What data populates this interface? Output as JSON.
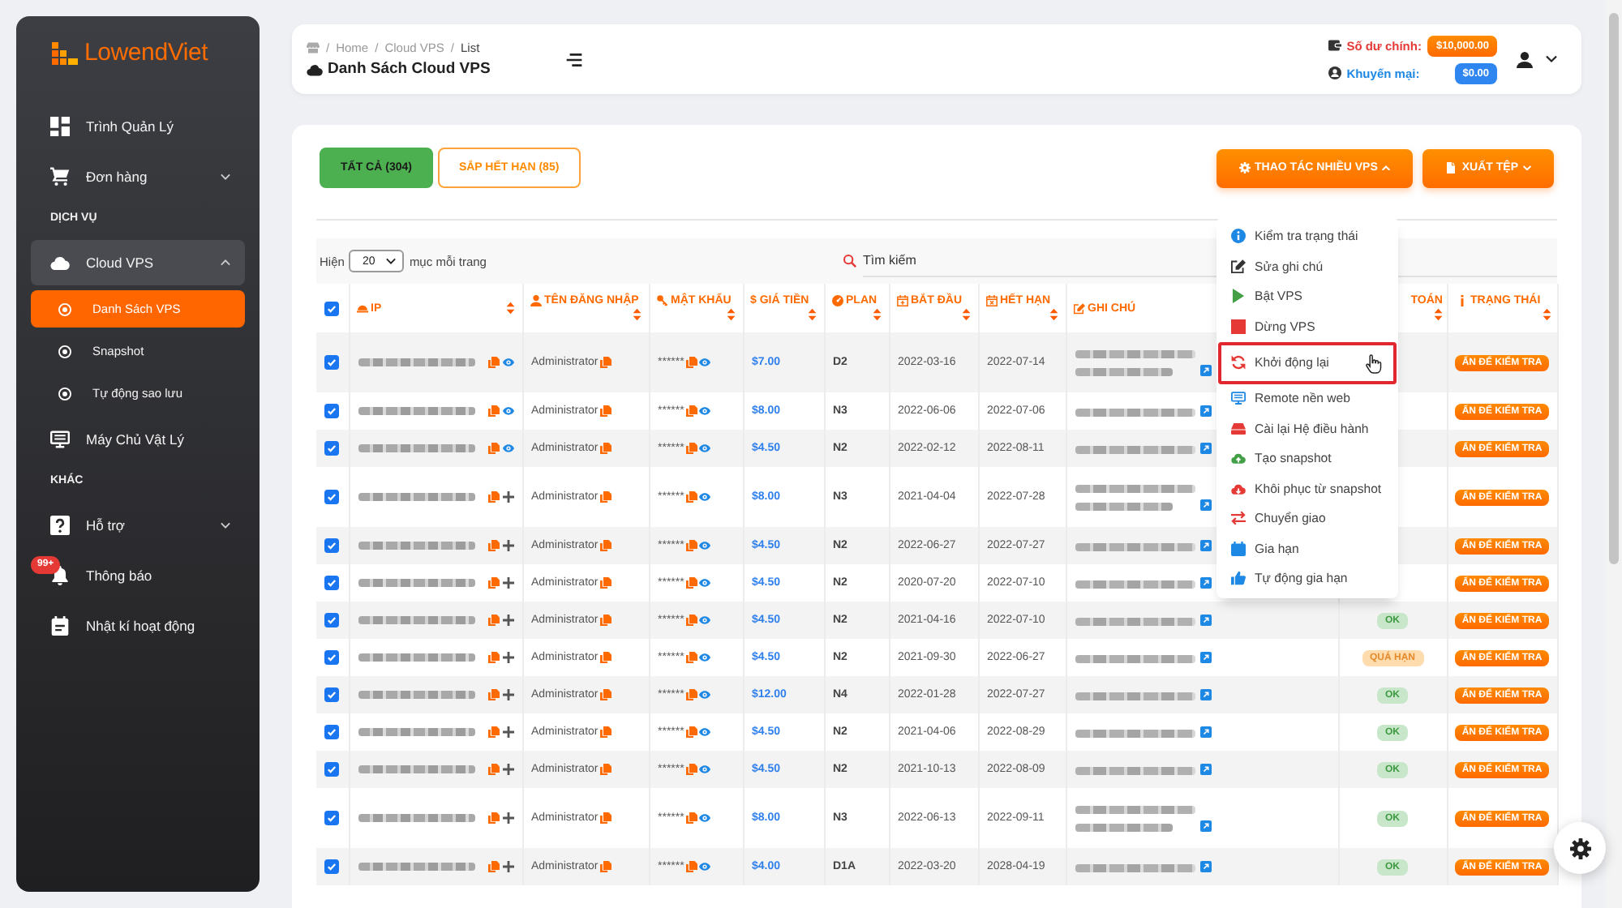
{
  "sidebar": {
    "logo": "LowendViet",
    "sections": [
      {
        "items": [
          {
            "label": "Trình Quản Lý",
            "kind": "link",
            "selected": false
          },
          {
            "label": "Đơn hàng",
            "kind": "group",
            "selected": false,
            "expanded": false
          }
        ]
      },
      {
        "title": "DỊCH VỤ",
        "items": [
          {
            "label": "Cloud VPS",
            "kind": "group",
            "selected": true,
            "expanded": true,
            "children": [
              {
                "label": "Danh Sách VPS",
                "selected": true
              },
              {
                "label": "Snapshot",
                "selected": false
              },
              {
                "label": "Tự động sao lưu",
                "selected": false
              }
            ]
          },
          {
            "label": "Máy Chủ Vật Lý",
            "kind": "link",
            "selected": false
          }
        ]
      },
      {
        "title": "KHÁC",
        "items": [
          {
            "label": "Hỗ trợ",
            "kind": "group",
            "selected": false,
            "expanded": false
          },
          {
            "label": "Thông báo",
            "kind": "link",
            "selected": false,
            "badge": "99+"
          },
          {
            "label": "Nhật kí hoạt động",
            "kind": "link",
            "selected": false
          }
        ]
      }
    ]
  },
  "header": {
    "breadcrumb": [
      {
        "separator": "/",
        "label": "Home",
        "current": false
      },
      {
        "separator": "/",
        "label": "Cloud VPS",
        "current": false
      },
      {
        "separator": "/",
        "label": "List",
        "current": true
      }
    ],
    "title": "Danh Sách Cloud VPS",
    "balances": [
      {
        "kind": "main",
        "label": "Số dư chính:",
        "amount": "$10,000.00"
      },
      {
        "kind": "promo",
        "label": "Khuyến mại:",
        "amount": "$0.00"
      }
    ]
  },
  "tabs": [
    {
      "label": "TẤT CẢ (304)",
      "selected": true
    },
    {
      "label": "SẮP HẾT HẠN (85)",
      "selected": false
    }
  ],
  "actions": [
    {
      "label": "THAO TÁC NHIỀU VPS",
      "expanded": true,
      "menu": [
        {
          "label": "Kiểm tra trạng thái",
          "selected": false
        },
        {
          "label": "Sửa ghi chú",
          "selected": false
        },
        {
          "label": "Bật VPS",
          "selected": false
        },
        {
          "label": "Dừng VPS",
          "selected": false
        },
        {
          "label": "Khởi động lại",
          "selected": true
        },
        {
          "label": "Remote nền web",
          "selected": false
        },
        {
          "label": "Cài lại Hệ điều hành",
          "selected": false
        },
        {
          "label": "Tạo snapshot",
          "selected": false
        },
        {
          "label": "Khôi phục từ snapshot",
          "selected": false
        },
        {
          "label": "Chuyển giao",
          "selected": false
        },
        {
          "label": "Gia hạn",
          "selected": false
        },
        {
          "label": "Tự động gia hạn",
          "selected": false
        }
      ]
    },
    {
      "label": "XUẤT TỆP",
      "expanded": false
    }
  ],
  "table_controls": {
    "show_label": "Hiện",
    "page_size": "20",
    "per_page_label": "mục mỗi trang",
    "search": {
      "placeholder": "Tìm kiếm"
    }
  },
  "table": {
    "all_checked": true,
    "columns": [
      {
        "label": "IP",
        "sort": true
      },
      {
        "label": "TÊN ĐĂNG NHẬP",
        "sort": true
      },
      {
        "label": "MẬT KHẨU",
        "sort": true
      },
      {
        "label": "$ GIÁ TIỀN",
        "sort": true
      },
      {
        "label": "PLAN",
        "sort": true
      },
      {
        "label": "BẮT ĐẦU",
        "sort": true
      },
      {
        "label": "HẾT HẠN",
        "sort": true
      },
      {
        "label": "GHI CHÚ"
      },
      {
        "label": "TOÁN",
        "sort": true
      },
      {
        "label": "TRẠNG THÁI",
        "sort": true
      }
    ],
    "rows": [
      {
        "checked": true,
        "kind": "reveal",
        "username": "Administrator",
        "password": "******",
        "price": "$7.00",
        "plan": "D2",
        "start": "2022-03-16",
        "end": "2022-07-14",
        "note_wrapped": true,
        "status": "ẤN ĐỂ KIỂM TRA"
      },
      {
        "checked": true,
        "kind": "reveal",
        "username": "Administrator",
        "password": "******",
        "price": "$8.00",
        "plan": "N3",
        "start": "2022-06-06",
        "end": "2022-07-06",
        "note_wrapped": false,
        "status": "ẤN ĐỂ KIỂM TRA"
      },
      {
        "checked": true,
        "kind": "reveal",
        "username": "Administrator",
        "password": "******",
        "price": "$4.50",
        "plan": "N2",
        "start": "2022-02-12",
        "end": "2022-08-11",
        "note_wrapped": false,
        "status": "ẤN ĐỂ KIỂM TRA"
      },
      {
        "checked": true,
        "kind": "add",
        "username": "Administrator",
        "password": "******",
        "price": "$8.00",
        "plan": "N3",
        "start": "2021-04-04",
        "end": "2022-07-28",
        "note_wrapped": true,
        "status": "ẤN ĐỂ KIỂM TRA"
      },
      {
        "checked": true,
        "kind": "add",
        "username": "Administrator",
        "password": "******",
        "price": "$4.50",
        "plan": "N2",
        "start": "2022-06-27",
        "end": "2022-07-27",
        "note_wrapped": false,
        "status": "ẤN ĐỂ KIỂM TRA"
      },
      {
        "checked": true,
        "kind": "add",
        "username": "Administrator",
        "password": "******",
        "price": "$4.50",
        "plan": "N2",
        "start": "2020-07-20",
        "end": "2022-07-10",
        "note_wrapped": false,
        "status": "ẤN ĐỂ KIỂM TRA"
      },
      {
        "checked": true,
        "kind": "add",
        "username": "Administrator",
        "password": "******",
        "price": "$4.50",
        "plan": "N2",
        "start": "2021-04-16",
        "end": "2022-07-10",
        "note_wrapped": false,
        "payment": {
          "label": "OK",
          "kind": "ok"
        },
        "status": "ẤN ĐỂ KIỂM TRA"
      },
      {
        "checked": true,
        "kind": "add",
        "username": "Administrator",
        "password": "******",
        "price": "$4.50",
        "plan": "N2",
        "start": "2021-09-30",
        "end": "2022-06-27",
        "note_wrapped": false,
        "payment": {
          "label": "QUÁ HẠN",
          "kind": "overdue"
        },
        "status": "ẤN ĐỂ KIỂM TRA"
      },
      {
        "checked": true,
        "kind": "add",
        "username": "Administrator",
        "password": "******",
        "price": "$12.00",
        "plan": "N4",
        "start": "2022-01-28",
        "end": "2022-07-27",
        "note_wrapped": false,
        "payment": {
          "label": "OK",
          "kind": "ok"
        },
        "status": "ẤN ĐỂ KIỂM TRA"
      },
      {
        "checked": true,
        "kind": "add",
        "username": "Administrator",
        "password": "******",
        "price": "$4.50",
        "plan": "N2",
        "start": "2021-04-06",
        "end": "2022-08-29",
        "note_wrapped": false,
        "payment": {
          "label": "OK",
          "kind": "ok"
        },
        "status": "ẤN ĐỂ KIỂM TRA"
      },
      {
        "checked": true,
        "kind": "add",
        "username": "Administrator",
        "password": "******",
        "price": "$4.50",
        "plan": "N2",
        "start": "2021-10-13",
        "end": "2022-08-09",
        "note_wrapped": false,
        "payment": {
          "label": "OK",
          "kind": "ok"
        },
        "status": "ẤN ĐỂ KIỂM TRA"
      },
      {
        "checked": true,
        "kind": "add",
        "username": "Administrator",
        "password": "******",
        "price": "$8.00",
        "plan": "N3",
        "start": "2022-06-13",
        "end": "2022-09-11",
        "note_wrapped": true,
        "payment": {
          "label": "OK",
          "kind": "ok"
        },
        "status": "ẤN ĐỂ KIỂM TRA"
      },
      {
        "checked": true,
        "kind": "add",
        "username": "Administrator",
        "password": "******",
        "price": "$4.00",
        "plan": "D1A",
        "start": "2022-03-20",
        "end": "2028-04-19",
        "note_wrapped": false,
        "payment": {
          "label": "OK",
          "kind": "ok"
        },
        "status": "ẤN ĐỂ KIỂM TRA"
      }
    ]
  }
}
